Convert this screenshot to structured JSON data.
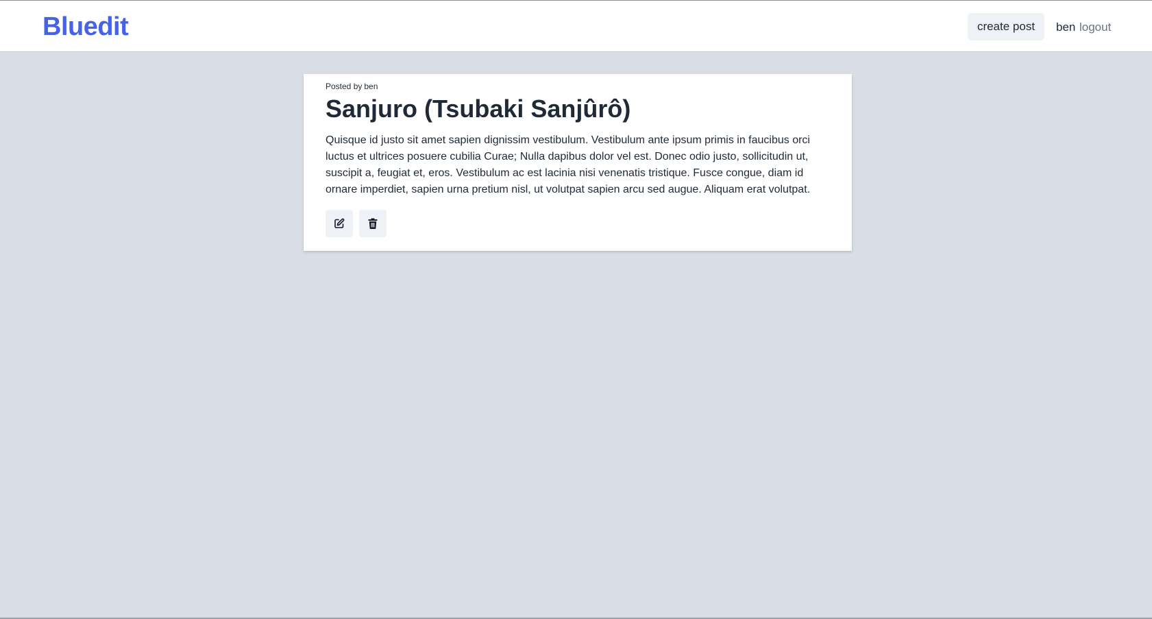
{
  "brand": {
    "name": "Bluedit",
    "color": "#4763e4"
  },
  "nav": {
    "create_post_label": "create post",
    "username": "ben",
    "logout_label": "logout"
  },
  "post": {
    "posted_by_label": "Posted by",
    "author": "ben",
    "title": "Sanjuro (Tsubaki Sanjûrô)",
    "body": "Quisque id justo sit amet sapien dignissim vestibulum. Vestibulum ante ipsum primis in faucibus orci luctus et ultrices posuere cubilia Curae; Nulla dapibus dolor vel est. Donec odio justo, sollicitudin ut, suscipit a, feugiat et, eros. Vestibulum ac est lacinia nisi venenatis tristique. Fusce congue, diam id ornare imperdiet, sapien urna pretium nisl, ut volutpat sapien arcu sed augue. Aliquam erat volutpat.",
    "actions": [
      {
        "icon": "edit-icon"
      },
      {
        "icon": "trash-icon"
      }
    ]
  },
  "colors": {
    "page_background": "#d9dee6",
    "card_background": "#ffffff",
    "button_background": "#eef1f5",
    "text": "#1f2937",
    "muted_text": "#6b7280"
  }
}
